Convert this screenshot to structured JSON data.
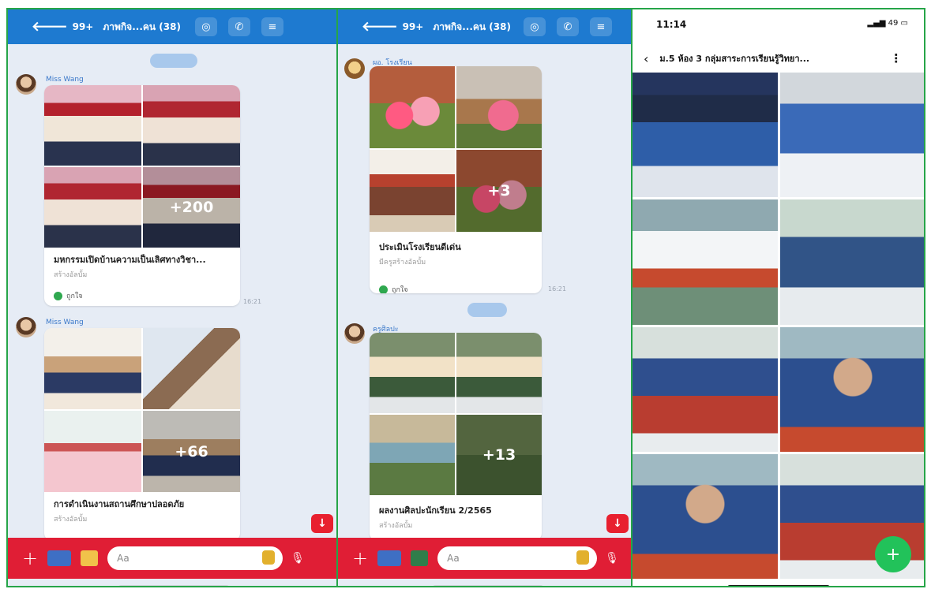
{
  "chat1": {
    "back_icon": "arrow-left-icon",
    "unread": "99+",
    "title": "ภาพกิจ...คน (38)",
    "date_label": "",
    "messages": [
      {
        "sender": "Miss Wang",
        "album_title": "มหกรรมเปิดบ้านความเป็นเลิศทางวิชา...",
        "album_sub": "สร้างอัลบั้ม",
        "more_count": "+200",
        "foot": "ถูกใจ",
        "time": "16:21"
      },
      {
        "sender": "Miss Wang",
        "album_title": "การดำเนินงานสถานศึกษาปลอดภัย",
        "album_sub": "สร้างอัลบั้ม",
        "more_count": "+66"
      }
    ],
    "input_placeholder": "Aa"
  },
  "chat2": {
    "unread": "99+",
    "title": "ภาพกิจ...คน (38)",
    "messages": [
      {
        "sender": "ผอ. โรงเรียน",
        "album_title": "ประเมินโรงเรียนดีเด่น",
        "album_sub": "มีครูสร้างอัลบั้ม",
        "more_count": "+3",
        "foot": "ถูกใจ",
        "time": "16:21"
      },
      {
        "sender": "ครูศิลปะ",
        "album_title": "ผลงานศิลปะนักเรียน 2/2565",
        "album_sub": "สร้างอัลบั้ม",
        "more_count": "+13"
      }
    ],
    "input_placeholder": "Aa"
  },
  "phone": {
    "clock": "11:14",
    "battery": "49",
    "album_title": "ม.5 ห้อง 3 กลุ่มสาระการเรียนรู้วิทยา...",
    "fab_label": "+"
  },
  "icons": {
    "scroll_down": "arrow-down-icon",
    "plus": "plus-icon",
    "mic": "microphone-icon"
  }
}
